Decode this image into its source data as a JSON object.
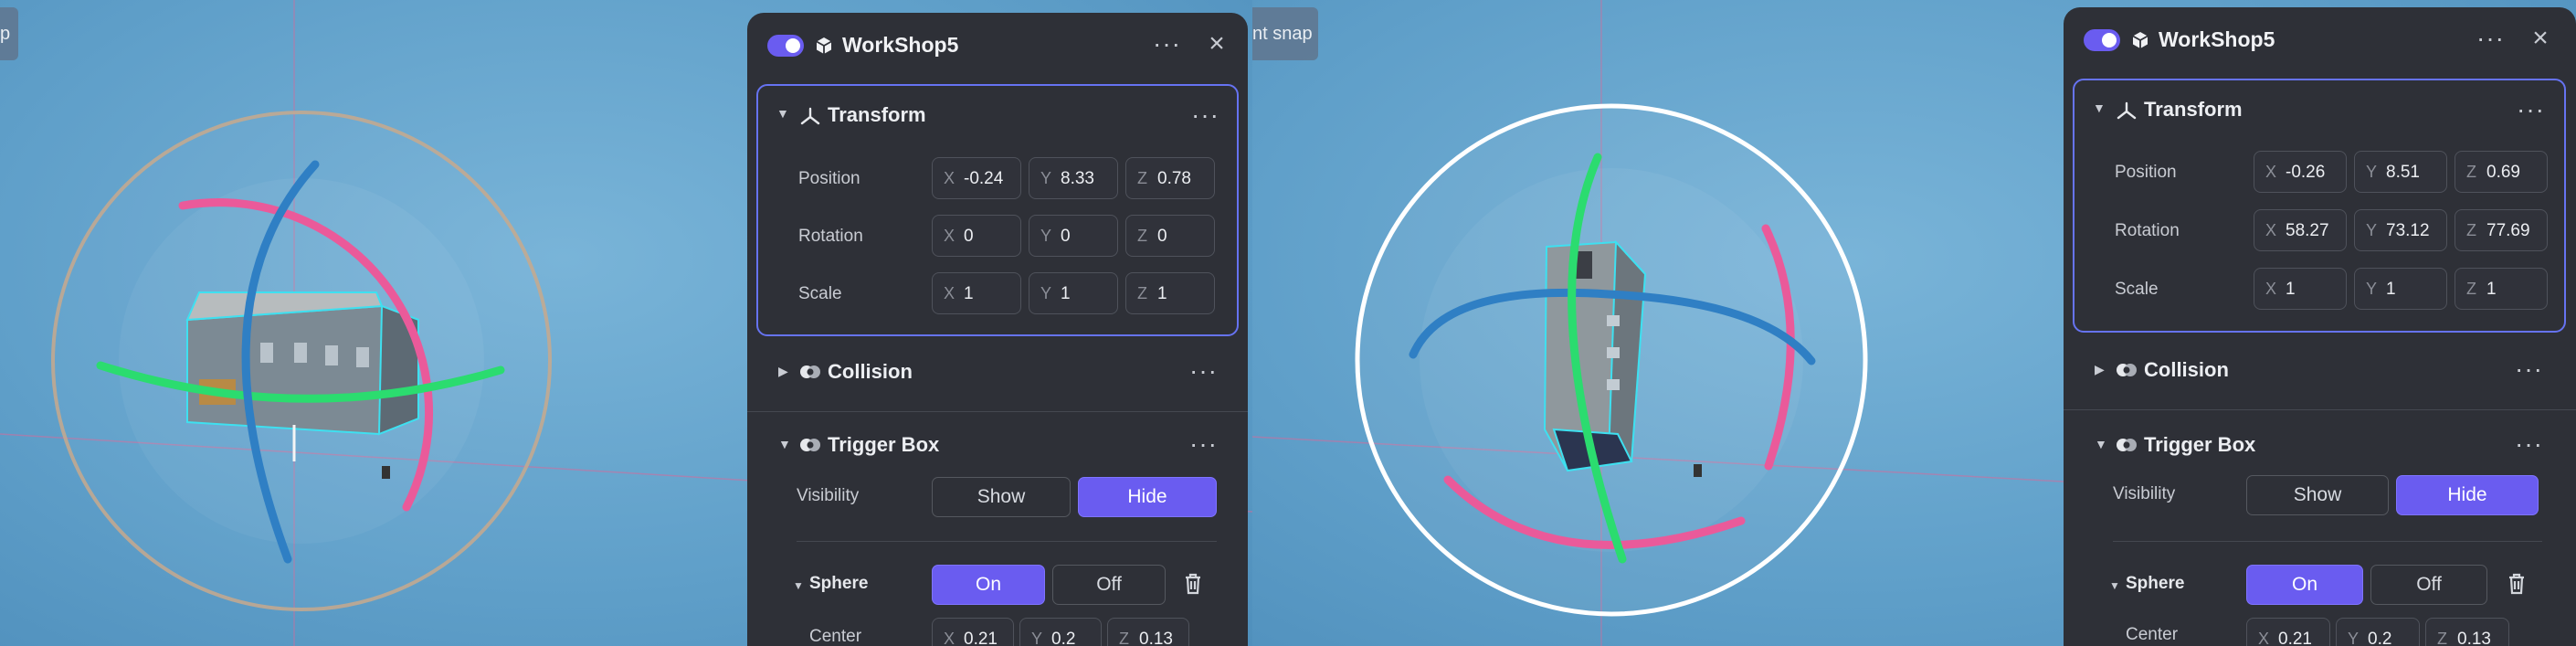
{
  "colors": {
    "accent": "#6a5cf0",
    "panel_bg": "#2e3037",
    "focus_border": "#6673f2",
    "gizmo_red": "#ea5a9a",
    "gizmo_green": "#2bdc6f",
    "gizmo_blue": "#2f7fc4"
  },
  "left": {
    "snap_label": "p",
    "panel": {
      "title": "WorkShop5",
      "transform": {
        "title": "Transform",
        "position": {
          "label": "Position",
          "x": "-0.24",
          "y": "8.33",
          "z": "0.78"
        },
        "rotation": {
          "label": "Rotation",
          "x": "0",
          "y": "0",
          "z": "0"
        },
        "scale": {
          "label": "Scale",
          "x": "1",
          "y": "1",
          "z": "1"
        }
      },
      "collision": {
        "title": "Collision"
      },
      "trigger_box": {
        "title": "Trigger Box",
        "visibility_label": "Visibility",
        "show": "Show",
        "hide": "Hide",
        "sphere": {
          "label": "Sphere",
          "on": "On",
          "off": "Off"
        },
        "center": {
          "label": "Center",
          "x": "0.21",
          "y": "0.2",
          "z": "0.13"
        }
      }
    }
  },
  "right": {
    "snap_label": "nt snap",
    "panel": {
      "title": "WorkShop5",
      "transform": {
        "title": "Transform",
        "position": {
          "label": "Position",
          "x": "-0.26",
          "y": "8.51",
          "z": "0.69"
        },
        "rotation": {
          "label": "Rotation",
          "x": "58.27",
          "y": "73.12",
          "z": "77.69"
        },
        "scale": {
          "label": "Scale",
          "x": "1",
          "y": "1",
          "z": "1"
        }
      },
      "collision": {
        "title": "Collision"
      },
      "trigger_box": {
        "title": "Trigger Box",
        "visibility_label": "Visibility",
        "show": "Show",
        "hide": "Hide",
        "sphere": {
          "label": "Sphere",
          "on": "On",
          "off": "Off"
        },
        "center": {
          "label": "Center",
          "x": "0.21",
          "y": "0.2",
          "z": "0.13"
        }
      }
    }
  },
  "axis_labels": {
    "x": "X",
    "y": "Y",
    "z": "Z"
  }
}
